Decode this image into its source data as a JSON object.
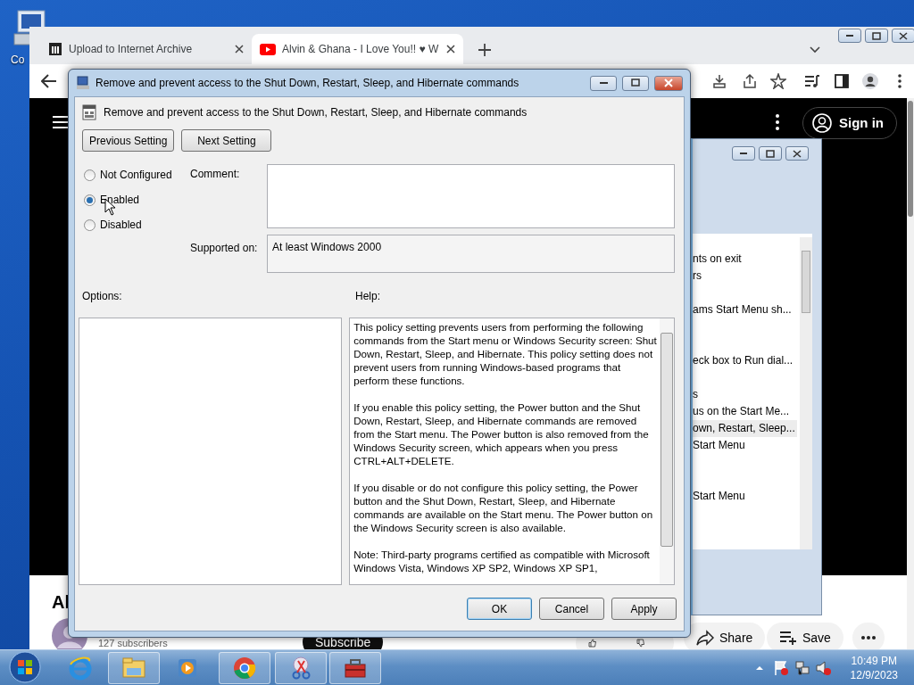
{
  "desktop": {
    "icon_label": "Co"
  },
  "browser": {
    "tabs": [
      {
        "title": "Upload to Internet Archive",
        "selected": false
      },
      {
        "title": "Alvin & Ghana - I Love You!! ♥ W",
        "selected": true
      }
    ],
    "page": {
      "sign_in": "Sign in",
      "channel_title": "Al",
      "subscribers": "127 subscribers",
      "subscribe": "Subscribe",
      "share": "Share",
      "save": "Save"
    }
  },
  "background_window": {
    "items": [
      {
        "text": "nts on exit",
        "selected": false
      },
      {
        "text": "rs",
        "selected": false
      },
      {
        "text": "ams Start Menu sh...",
        "selected": false
      },
      {
        "text": "eck box to Run dial...",
        "selected": false
      },
      {
        "text": "s",
        "selected": false
      },
      {
        "text": "us on the Start Me...",
        "selected": false
      },
      {
        "text": "own, Restart, Sleep...",
        "selected": true
      },
      {
        "text": "Start Menu",
        "selected": false
      },
      {
        "text": "Start Menu",
        "selected": false
      }
    ]
  },
  "dialog": {
    "title": "Remove and prevent access to the Shut Down, Restart, Sleep, and Hibernate commands",
    "heading": "Remove and prevent access to the Shut Down, Restart, Sleep, and Hibernate commands",
    "nav_buttons": [
      "Previous Setting",
      "Next Setting"
    ],
    "states": [
      {
        "label": "Not Configured",
        "selected": false
      },
      {
        "label": "Enabled",
        "selected": true
      },
      {
        "label": "Disabled",
        "selected": false
      }
    ],
    "comment_label": "Comment:",
    "supported_label": "Supported on:",
    "supported_value": "At least Windows 2000",
    "options_label": "Options:",
    "help_label": "Help:",
    "help": [
      "This policy setting prevents users from performing the following commands from the Start menu or Windows Security screen: Shut Down, Restart, Sleep, and Hibernate. This policy setting does not prevent users from running Windows-based programs that perform these functions.",
      "If you enable this policy setting, the Power button and the Shut Down, Restart, Sleep, and Hibernate commands are removed from the Start menu. The Power button is also removed from the Windows Security screen, which appears when you press CTRL+ALT+DELETE.",
      "If you disable or do not configure this policy setting, the Power button and the Shut Down, Restart, Sleep, and Hibernate commands are available on the Start menu. The Power button on the Windows Security screen is also available.",
      "Note: Third-party programs certified as compatible with Microsoft Windows Vista, Windows XP SP2, Windows XP SP1,"
    ],
    "buttons": [
      {
        "label": "OK",
        "default": true
      },
      {
        "label": "Cancel",
        "default": false
      },
      {
        "label": "Apply",
        "default": false
      }
    ]
  },
  "taskbar": {
    "apps": [
      {
        "kind": "ie",
        "open": false
      },
      {
        "kind": "explorer",
        "open": true
      },
      {
        "kind": "media",
        "open": false
      },
      {
        "kind": "chrome",
        "open": true
      },
      {
        "kind": "snip",
        "open": true
      },
      {
        "kind": "toolbox",
        "open": true
      }
    ],
    "time": "10:49 PM",
    "date": "12/9/2023"
  }
}
